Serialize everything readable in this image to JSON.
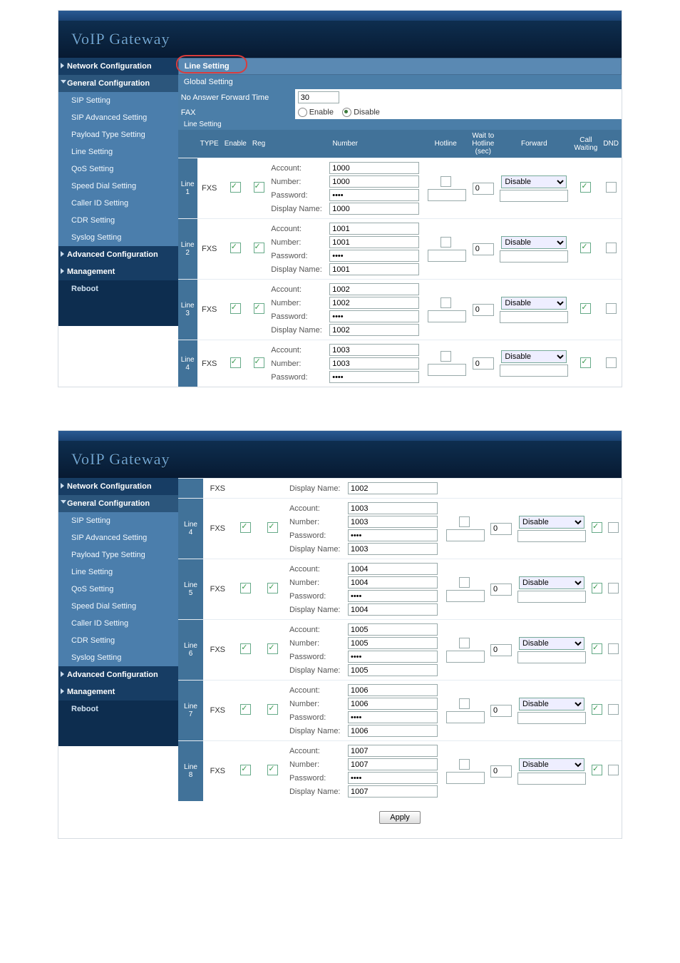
{
  "brand": "VoIP  Gateway",
  "side": {
    "net": "Network Configuration",
    "gen": "General Configuration",
    "sip": "SIP Setting",
    "sipadv": "SIP Advanced Setting",
    "payload": "Payload Type Setting",
    "line": "Line Setting",
    "qos": "QoS Setting",
    "speed": "Speed Dial Setting",
    "cid": "Caller ID Setting",
    "cdr": "CDR Setting",
    "syslog": "Syslog Setting",
    "adv": "Advanced Configuration",
    "mgmt": "Management",
    "reboot": "Reboot"
  },
  "sections": {
    "line": "Line Setting",
    "global": "Global Setting",
    "line_head": "Line Setting"
  },
  "fax": {
    "title": "FAX",
    "fwdlabel": "No Answer Forward Time",
    "fwdval": "30",
    "enable": "Enable",
    "disable": "Disable"
  },
  "cols": {
    "type": "TYPE",
    "enable": "Enable",
    "reg": "Reg",
    "number": "Number",
    "hotline": "Hotline",
    "wait": "Wait to Hotline (sec)",
    "forward": "Forward",
    "cw": "Call Waiting",
    "dnd": "DND"
  },
  "fields": {
    "account": "Account:",
    "number": "Number:",
    "password": "Password:",
    "display": "Display Name:"
  },
  "forward_opt": "Disable",
  "wait_default": "0",
  "apply": "Apply",
  "chart_data": {
    "type": "table",
    "columns": [
      "line",
      "type",
      "enable",
      "reg",
      "account",
      "number",
      "password",
      "display_name",
      "hotline_checked",
      "wait_to_hotline_sec",
      "forward",
      "call_waiting",
      "dnd"
    ],
    "rows": [
      [
        "Line 1",
        "FXS",
        true,
        true,
        "1000",
        "1000",
        "••••",
        "1000",
        false,
        "0",
        "Disable",
        true,
        false
      ],
      [
        "Line 2",
        "FXS",
        true,
        true,
        "1001",
        "1001",
        "••••",
        "1001",
        false,
        "0",
        "Disable",
        true,
        false
      ],
      [
        "Line 3",
        "FXS",
        true,
        true,
        "1002",
        "1002",
        "••••",
        "1002",
        false,
        "0",
        "Disable",
        true,
        false
      ],
      [
        "Line 4",
        "FXS",
        true,
        true,
        "1003",
        "1003",
        "••••",
        "1003",
        false,
        "0",
        "Disable",
        true,
        false
      ],
      [
        "Line 5",
        "FXS",
        true,
        true,
        "1004",
        "1004",
        "••••",
        "1004",
        false,
        "0",
        "Disable",
        true,
        false
      ],
      [
        "Line 6",
        "FXS",
        true,
        true,
        "1005",
        "1005",
        "••••",
        "1005",
        false,
        "0",
        "Disable",
        true,
        false
      ],
      [
        "Line 7",
        "FXS",
        true,
        true,
        "1006",
        "1006",
        "••••",
        "1006",
        false,
        "0",
        "Disable",
        true,
        false
      ],
      [
        "Line 8",
        "FXS",
        true,
        true,
        "1007",
        "1007",
        "••••",
        "1007",
        false,
        "0",
        "Disable",
        true,
        false
      ]
    ]
  },
  "lines": [
    {
      "idx": "Line 1",
      "acct": "1000",
      "num": "1000",
      "pw": "••••",
      "dn": "1000"
    },
    {
      "idx": "Line 2",
      "acct": "1001",
      "num": "1001",
      "pw": "••••",
      "dn": "1001"
    },
    {
      "idx": "Line 3",
      "acct": "1002",
      "num": "1002",
      "pw": "••••",
      "dn": "1002"
    },
    {
      "idx": "Line 4",
      "acct": "1003",
      "num": "1003",
      "pw": "••••",
      "dn": "1003"
    },
    {
      "idx": "Line 5",
      "acct": "1004",
      "num": "1004",
      "pw": "••••",
      "dn": "1004"
    },
    {
      "idx": "Line 6",
      "acct": "1005",
      "num": "1005",
      "pw": "••••",
      "dn": "1005"
    },
    {
      "idx": "Line 7",
      "acct": "1006",
      "num": "1006",
      "pw": "••••",
      "dn": "1006"
    },
    {
      "idx": "Line 8",
      "acct": "1007",
      "num": "1007",
      "pw": "••••",
      "dn": "1007"
    }
  ]
}
